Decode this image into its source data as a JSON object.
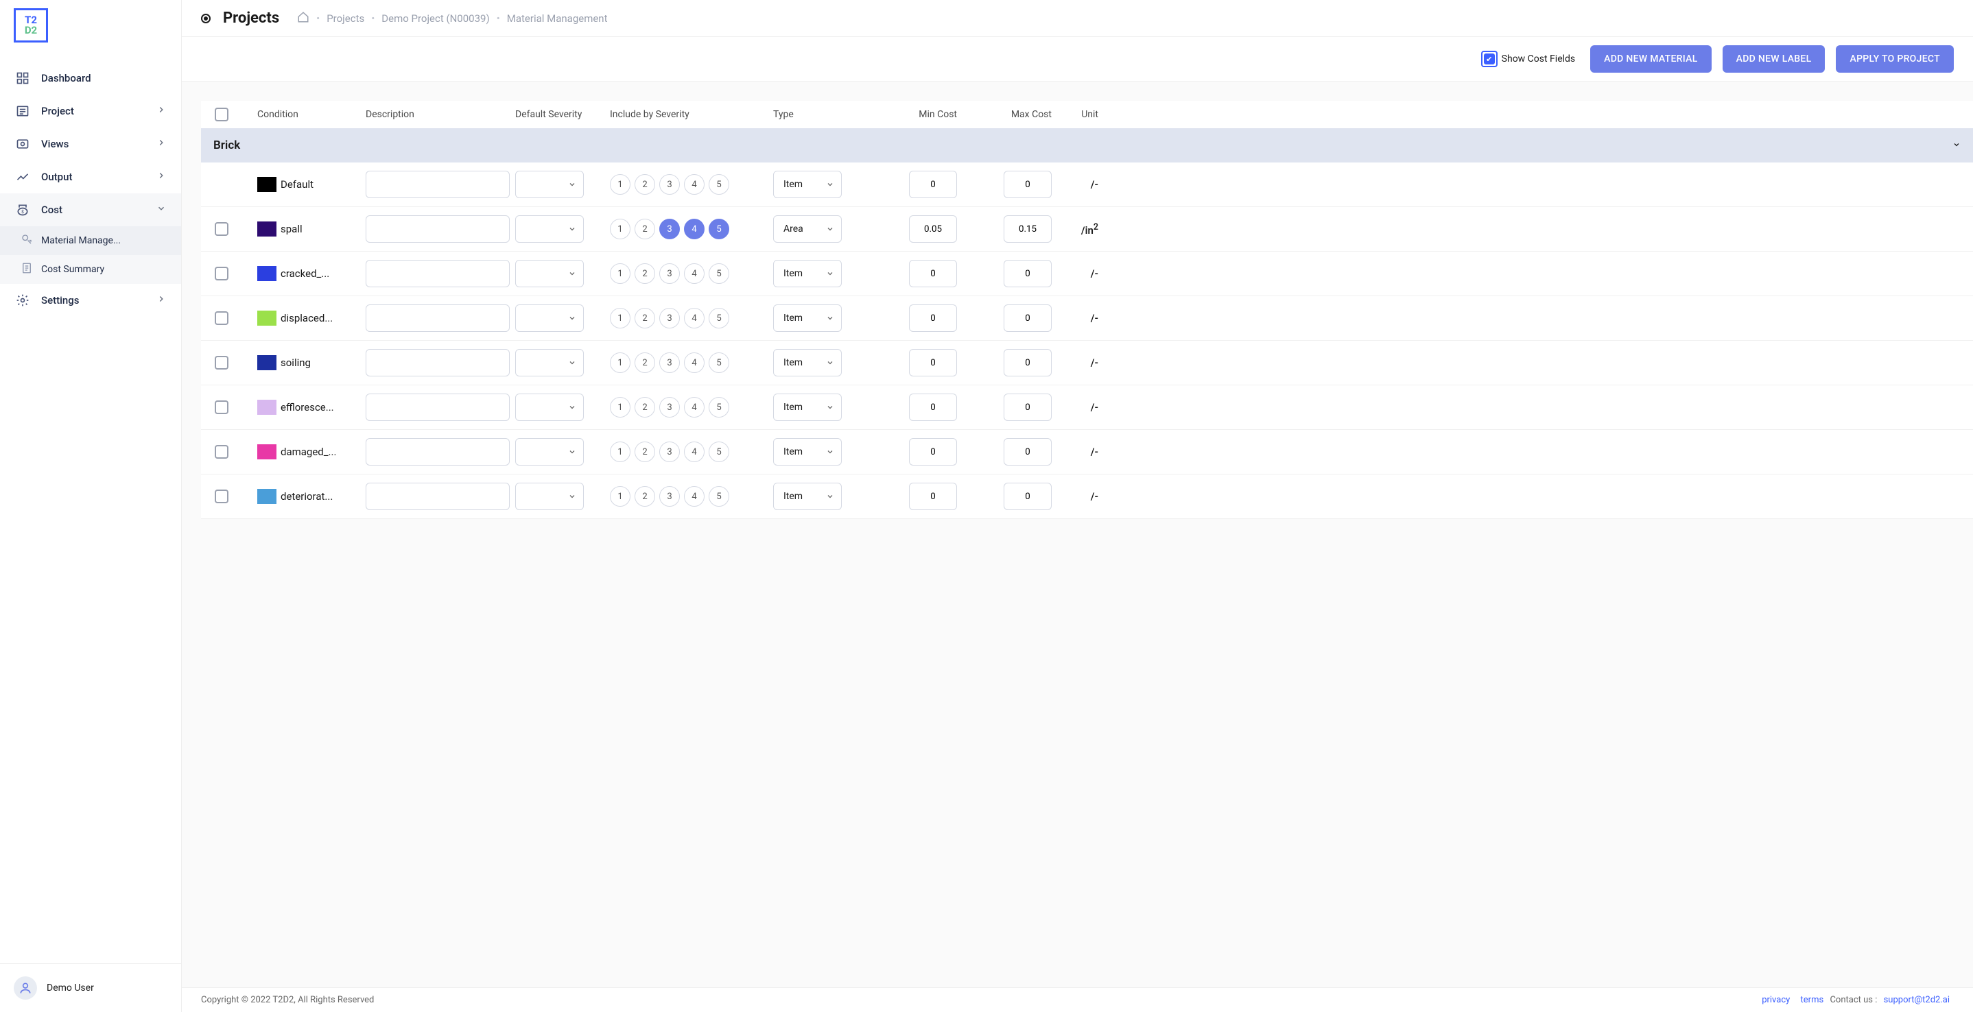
{
  "logo": {
    "line1": "T2",
    "line2": "D2"
  },
  "nav": {
    "dashboard": "Dashboard",
    "project": "Project",
    "views": "Views",
    "output": "Output",
    "cost": "Cost",
    "material_mgmt": "Material Manage...",
    "cost_summary": "Cost Summary",
    "settings": "Settings"
  },
  "user": {
    "name": "Demo User"
  },
  "header": {
    "title": "Projects",
    "crumbs": {
      "projects": "Projects",
      "demo": "Demo Project (N00039)",
      "mm": "Material Management"
    }
  },
  "toolbar": {
    "show_cost": "Show Cost Fields",
    "add_material": "ADD NEW MATERIAL",
    "add_label": "ADD NEW LABEL",
    "apply": "APPLY TO PROJECT"
  },
  "columns": {
    "condition": "Condition",
    "description": "Description",
    "default_severity": "Default Severity",
    "include_by_severity": "Include by Severity",
    "type": "Type",
    "min_cost": "Min Cost",
    "max_cost": "Max Cost",
    "unit": "Unit"
  },
  "group": {
    "name": "Brick"
  },
  "types": {
    "item": "Item",
    "area": "Area"
  },
  "rows": [
    {
      "color": "#000000",
      "label": "Default",
      "severity": [
        1,
        2,
        3,
        4,
        5
      ],
      "active": [],
      "type": "Item",
      "min": "0",
      "max": "0",
      "unit": "/-",
      "chk": false
    },
    {
      "color": "#2d0b70",
      "label": "spall",
      "severity": [
        1,
        2,
        3,
        4,
        5
      ],
      "active": [
        3,
        4,
        5
      ],
      "type": "Area",
      "min": "0.05",
      "max": "0.15",
      "unit": "/in²",
      "chk": true
    },
    {
      "color": "#2b3fe0",
      "label": "cracked_...",
      "severity": [
        1,
        2,
        3,
        4,
        5
      ],
      "active": [],
      "type": "Item",
      "min": "0",
      "max": "0",
      "unit": "/-",
      "chk": true
    },
    {
      "color": "#9be04a",
      "label": "displaced...",
      "severity": [
        1,
        2,
        3,
        4,
        5
      ],
      "active": [],
      "type": "Item",
      "min": "0",
      "max": "0",
      "unit": "/-",
      "chk": true
    },
    {
      "color": "#1c2fa0",
      "label": "soiling",
      "severity": [
        1,
        2,
        3,
        4,
        5
      ],
      "active": [],
      "type": "Item",
      "min": "0",
      "max": "0",
      "unit": "/-",
      "chk": true
    },
    {
      "color": "#d8b8ef",
      "label": "effloresce...",
      "severity": [
        1,
        2,
        3,
        4,
        5
      ],
      "active": [],
      "type": "Item",
      "min": "0",
      "max": "0",
      "unit": "/-",
      "chk": true
    },
    {
      "color": "#e838a6",
      "label": "damaged_...",
      "severity": [
        1,
        2,
        3,
        4,
        5
      ],
      "active": [],
      "type": "Item",
      "min": "0",
      "max": "0",
      "unit": "/-",
      "chk": true
    },
    {
      "color": "#4a9ed9",
      "label": "deteriorat...",
      "severity": [
        1,
        2,
        3,
        4,
        5
      ],
      "active": [],
      "type": "Item",
      "min": "0",
      "max": "0",
      "unit": "/-",
      "chk": true
    }
  ],
  "footer": {
    "copyright": "Copyright © 2022 T2D2, All Rights Reserved",
    "privacy": "privacy",
    "terms": "terms",
    "contact": "Contact us :",
    "email": "support@t2d2.ai"
  }
}
